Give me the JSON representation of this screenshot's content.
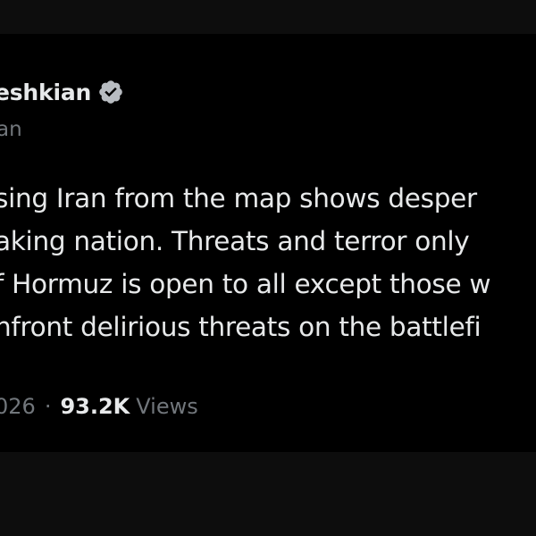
{
  "post": {
    "display_name": "eshkian",
    "handle": "an",
    "verified_icon": "verified-badge-icon",
    "verified_color": "#b8bcc1",
    "body_lines": [
      "sing Iran from the map shows desper",
      "aking nation. Threats and terror only",
      "f Hormuz is open to all except those w",
      "nfront delirious threats on the battlefi"
    ],
    "date": "026",
    "separator": "·",
    "view_count": "93.2K",
    "views_label": "Views"
  },
  "colors": {
    "background": "#000000",
    "primary_text": "#e7e9ea",
    "secondary_text": "#71767b"
  }
}
